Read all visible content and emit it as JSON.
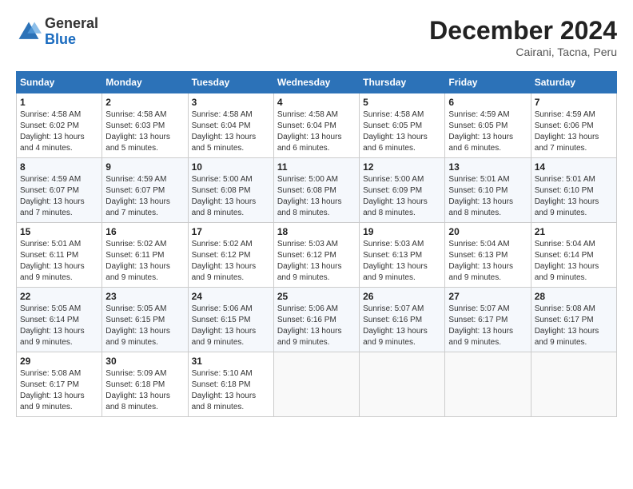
{
  "header": {
    "logo_line1": "General",
    "logo_line2": "Blue",
    "month_title": "December 2024",
    "location": "Cairani, Tacna, Peru"
  },
  "calendar": {
    "days_of_week": [
      "Sunday",
      "Monday",
      "Tuesday",
      "Wednesday",
      "Thursday",
      "Friday",
      "Saturday"
    ],
    "weeks": [
      [
        null,
        null,
        null,
        null,
        null,
        null,
        null
      ]
    ]
  },
  "days": {
    "d1": {
      "num": "1",
      "rise": "4:58 AM",
      "set": "6:02 PM",
      "hours": "13",
      "mins": "4"
    },
    "d2": {
      "num": "2",
      "rise": "4:58 AM",
      "set": "6:03 PM",
      "hours": "13",
      "mins": "5"
    },
    "d3": {
      "num": "3",
      "rise": "4:58 AM",
      "set": "6:04 PM",
      "hours": "13",
      "mins": "5"
    },
    "d4": {
      "num": "4",
      "rise": "4:58 AM",
      "set": "6:04 PM",
      "hours": "13",
      "mins": "6"
    },
    "d5": {
      "num": "5",
      "rise": "4:58 AM",
      "set": "6:05 PM",
      "hours": "13",
      "mins": "6"
    },
    "d6": {
      "num": "6",
      "rise": "4:59 AM",
      "set": "6:05 PM",
      "hours": "13",
      "mins": "6"
    },
    "d7": {
      "num": "7",
      "rise": "4:59 AM",
      "set": "6:06 PM",
      "hours": "13",
      "mins": "7"
    },
    "d8": {
      "num": "8",
      "rise": "4:59 AM",
      "set": "6:07 PM",
      "hours": "13",
      "mins": "7"
    },
    "d9": {
      "num": "9",
      "rise": "4:59 AM",
      "set": "6:07 PM",
      "hours": "13",
      "mins": "7"
    },
    "d10": {
      "num": "10",
      "rise": "5:00 AM",
      "set": "6:08 PM",
      "hours": "13",
      "mins": "8"
    },
    "d11": {
      "num": "11",
      "rise": "5:00 AM",
      "set": "6:08 PM",
      "hours": "13",
      "mins": "8"
    },
    "d12": {
      "num": "12",
      "rise": "5:00 AM",
      "set": "6:09 PM",
      "hours": "13",
      "mins": "8"
    },
    "d13": {
      "num": "13",
      "rise": "5:01 AM",
      "set": "6:10 PM",
      "hours": "13",
      "mins": "8"
    },
    "d14": {
      "num": "14",
      "rise": "5:01 AM",
      "set": "6:10 PM",
      "hours": "13",
      "mins": "9"
    },
    "d15": {
      "num": "15",
      "rise": "5:01 AM",
      "set": "6:11 PM",
      "hours": "13",
      "mins": "9"
    },
    "d16": {
      "num": "16",
      "rise": "5:02 AM",
      "set": "6:11 PM",
      "hours": "13",
      "mins": "9"
    },
    "d17": {
      "num": "17",
      "rise": "5:02 AM",
      "set": "6:12 PM",
      "hours": "13",
      "mins": "9"
    },
    "d18": {
      "num": "18",
      "rise": "5:03 AM",
      "set": "6:12 PM",
      "hours": "13",
      "mins": "9"
    },
    "d19": {
      "num": "19",
      "rise": "5:03 AM",
      "set": "6:13 PM",
      "hours": "13",
      "mins": "9"
    },
    "d20": {
      "num": "20",
      "rise": "5:04 AM",
      "set": "6:13 PM",
      "hours": "13",
      "mins": "9"
    },
    "d21": {
      "num": "21",
      "rise": "5:04 AM",
      "set": "6:14 PM",
      "hours": "13",
      "mins": "9"
    },
    "d22": {
      "num": "22",
      "rise": "5:05 AM",
      "set": "6:14 PM",
      "hours": "13",
      "mins": "9"
    },
    "d23": {
      "num": "23",
      "rise": "5:05 AM",
      "set": "6:15 PM",
      "hours": "13",
      "mins": "9"
    },
    "d24": {
      "num": "24",
      "rise": "5:06 AM",
      "set": "6:15 PM",
      "hours": "13",
      "mins": "9"
    },
    "d25": {
      "num": "25",
      "rise": "5:06 AM",
      "set": "6:16 PM",
      "hours": "13",
      "mins": "9"
    },
    "d26": {
      "num": "26",
      "rise": "5:07 AM",
      "set": "6:16 PM",
      "hours": "13",
      "mins": "9"
    },
    "d27": {
      "num": "27",
      "rise": "5:07 AM",
      "set": "6:17 PM",
      "hours": "13",
      "mins": "9"
    },
    "d28": {
      "num": "28",
      "rise": "5:08 AM",
      "set": "6:17 PM",
      "hours": "13",
      "mins": "9"
    },
    "d29": {
      "num": "29",
      "rise": "5:08 AM",
      "set": "6:17 PM",
      "hours": "13",
      "mins": "9"
    },
    "d30": {
      "num": "30",
      "rise": "5:09 AM",
      "set": "6:18 PM",
      "hours": "13",
      "mins": "8"
    },
    "d31": {
      "num": "31",
      "rise": "5:10 AM",
      "set": "6:18 PM",
      "hours": "13",
      "mins": "8"
    }
  }
}
